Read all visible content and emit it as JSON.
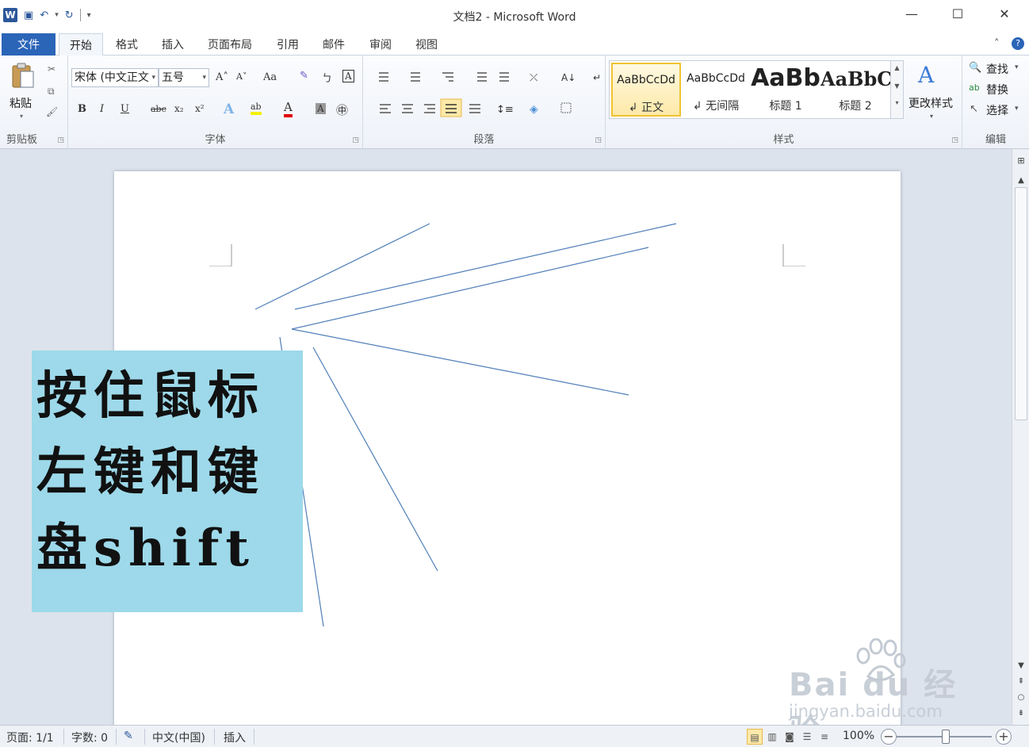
{
  "window": {
    "title": "文档2 - Microsoft Word",
    "app_icon_letter": "W",
    "controls": {
      "minimize": "—",
      "maximize": "☐",
      "close": "✕"
    }
  },
  "quick_access": {
    "save": "▣",
    "undo": "↶",
    "undo_dropdown": "▾",
    "redo": "↻",
    "customize": "▾"
  },
  "tabs": {
    "file": "文件",
    "items": [
      "开始",
      "格式",
      "插入",
      "页面布局",
      "引用",
      "邮件",
      "审阅",
      "视图"
    ],
    "active": "开始",
    "help_caret": "˄",
    "help": "?"
  },
  "ribbon": {
    "clipboard": {
      "paste_label": "粘贴",
      "paste_caret": "▾",
      "cut": "✂",
      "copy": "⧉",
      "format_painter": "🖌",
      "group_label": "剪贴板"
    },
    "font": {
      "font_name": "宋体 (中文正文",
      "font_size": "五号",
      "grow": "A˄",
      "shrink": "A˅",
      "change_case": "Aa",
      "clear_format": "✎",
      "phonetic": "ㄅ",
      "char_border": "A",
      "bold": "B",
      "italic": "I",
      "underline": "U",
      "strikethrough": "abc",
      "subscript": "x₂",
      "superscript": "x²",
      "text_effect": "A",
      "highlight": "ab",
      "font_color": "A",
      "char_shading": "A",
      "enclose": "㊥",
      "group_label": "字体"
    },
    "paragraph": {
      "group_label": "段落"
    },
    "styles": {
      "items": [
        {
          "preview": "AaBbCcDd",
          "name": "↲ 正文"
        },
        {
          "preview": "AaBbCcDd",
          "name": "↲ 无间隔"
        },
        {
          "preview": "AaBb",
          "name": "标题 1"
        },
        {
          "preview": "AaBbC",
          "name": "标题 2"
        }
      ],
      "change_styles": "更改样式",
      "change_styles_caret": "▾",
      "group_label": "样式"
    },
    "editing": {
      "find": "查找",
      "find_caret": "▾",
      "replace": "替换",
      "select": "选择",
      "select_caret": "▾",
      "group_label": "编辑"
    }
  },
  "document": {
    "callout_lines": [
      "按住鼠标",
      "左键和键",
      "盘shift"
    ]
  },
  "scrollbar": {
    "up": "▲",
    "down": "▼",
    "prev_page": "⇞",
    "browse": "○",
    "next_page": "⇟"
  },
  "watermark": {
    "brand": "Bai du 经验",
    "url": "jingyan.baidu.com"
  },
  "statusbar": {
    "page": "页面: 1/1",
    "words": "字数: 0",
    "language": "中文(中国)",
    "mode": "插入",
    "zoom": "100%",
    "zoom_out": "−",
    "zoom_in": "+"
  }
}
